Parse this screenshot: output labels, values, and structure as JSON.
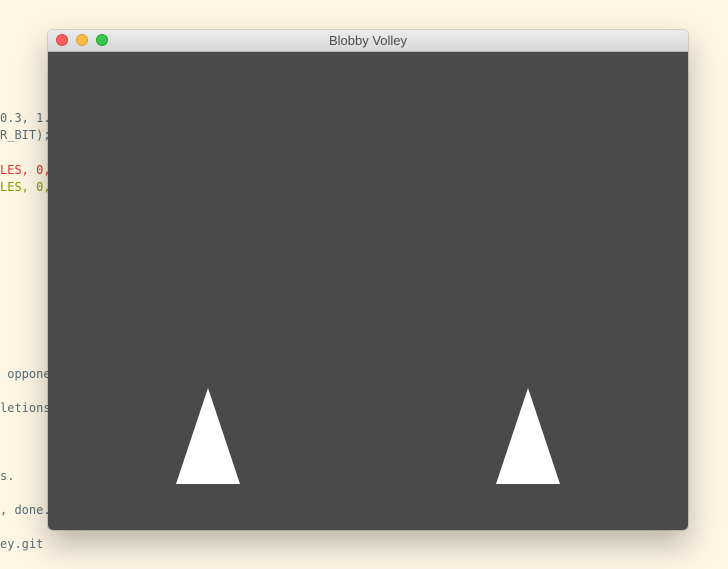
{
  "window": {
    "title": "Blobby Volley"
  },
  "background_code": [
    {
      "text": "0.3, 1.",
      "color": "#586e75"
    },
    {
      "text": "R_BIT);",
      "color": "#586e75"
    },
    {
      "text": "LES, 0,",
      "color": "#dc322f"
    },
    {
      "text": "LES, 0,",
      "color": "#859900"
    },
    {
      "text": " oppone",
      "color": "#586e75"
    },
    {
      "text": "letions",
      "color": "#586e75"
    },
    {
      "text": "s.",
      "color": "#586e75"
    },
    {
      "text": ", done.",
      "color": "#586e75"
    },
    {
      "text": "ey.git",
      "color": "#586e75"
    }
  ],
  "game": {
    "background_color": "#4a4a4a",
    "player_color": "#ffffff",
    "players": [
      "left",
      "right"
    ]
  }
}
